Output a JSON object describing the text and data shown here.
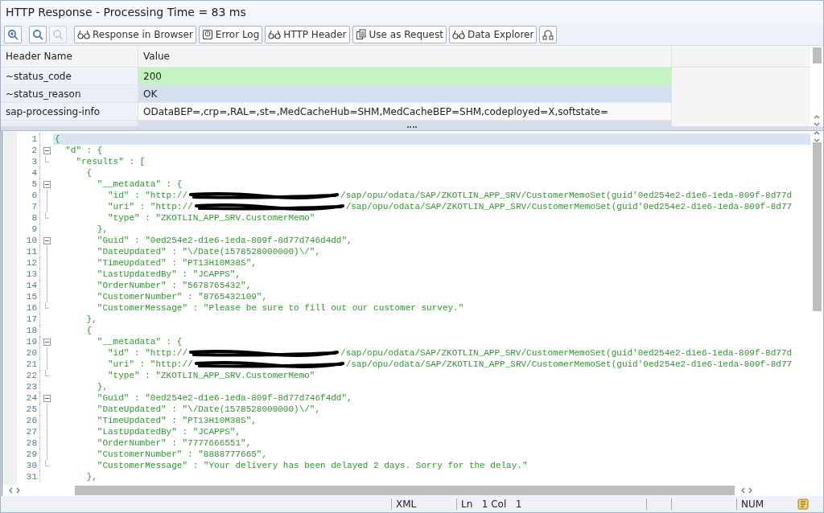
{
  "window": {
    "title": "HTTP Response - Processing Time = 83  ms"
  },
  "toolbar": [
    {
      "disabled": false
    },
    {
      "disabled": false
    },
    {
      "disabled": true
    },
    {
      "label": "Response in Browser",
      "disabled": false
    },
    {
      "label": "Error Log",
      "disabled": false
    },
    {
      "label": "HTTP Header",
      "disabled": false
    },
    {
      "label": "Use as Request",
      "disabled": false
    },
    {
      "label": "Data Explorer",
      "disabled": false
    },
    {
      "disabled": false
    }
  ],
  "header_table": {
    "columns": [
      "Header Name",
      "Value"
    ],
    "rows": [
      {
        "name": "~status_code",
        "value": "200",
        "color": "#c4f5c0"
      },
      {
        "name": "~status_reason",
        "value": "OK",
        "color": "#d5e0ef"
      },
      {
        "name": "sap-processing-info",
        "value": "ODataBEP=,crp=,RAL=,st=,MedCacheHub=SHM,MedCacheBEP=SHM,codeployed=X,softstate=",
        "color": "#fafafa"
      },
      {
        "color": "#d5e0ef"
      }
    ]
  },
  "editor": {
    "lines": [
      {
        "num": "1",
        "kind": "plain",
        "text": "{",
        "current": true
      },
      {
        "num": "2",
        "kind": "open",
        "text": "  \"d\" : {",
        "current": false
      },
      {
        "num": "3",
        "kind": "end",
        "text": "    \"results\" : [",
        "current": false
      },
      {
        "num": "4",
        "kind": "plain",
        "text": "      {",
        "current": false
      },
      {
        "num": "5",
        "kind": "open",
        "text": "        \"__metadata\" : {",
        "current": false
      },
      {
        "num": "6",
        "kind": "line",
        "text": "          \"id\" : \"http://",
        "redacted": true,
        "rest": "/sap/opu/odata/SAP/ZKOTLIN_APP_SRV/CustomerMemoSet(guid'0ed254e2-d1e6-1eda-809f-8d77d",
        "current": false
      },
      {
        "num": "7",
        "kind": "line",
        "text": "          \"uri\" : \"http://",
        "redacted": true,
        "rest": "/sap/opu/odata/SAP/ZKOTLIN_APP_SRV/CustomerMemoSet(guid'0ed254e2-d1e6-1eda-809f-8d77",
        "current": false
      },
      {
        "num": "8",
        "kind": "end",
        "text": "          \"type\" : \"ZKOTLIN_APP_SRV.CustomerMemo\"",
        "current": false
      },
      {
        "num": "9",
        "kind": "plain",
        "text": "        },",
        "current": false
      },
      {
        "num": "10",
        "kind": "open",
        "text": "        \"Guid\" : \"0ed254e2-d1e6-1eda-809f-8d77d746d4dd\",",
        "current": false
      },
      {
        "num": "11",
        "kind": "line",
        "text": "        \"DateUpdated\" : \"\\/Date(1578528000000)\\/\",",
        "current": false
      },
      {
        "num": "12",
        "kind": "line",
        "text": "        \"TimeUpdated\" : \"PT13H10M38S\",",
        "current": false
      },
      {
        "num": "13",
        "kind": "line",
        "text": "        \"LastUpdatedBy\" : \"JCAPPS\",",
        "current": false
      },
      {
        "num": "14",
        "kind": "line",
        "text": "        \"OrderNumber\" : \"5678765432\",",
        "current": false
      },
      {
        "num": "15",
        "kind": "line",
        "text": "        \"CustomerNumber\" : \"8765432109\",",
        "current": false
      },
      {
        "num": "16",
        "kind": "end",
        "text": "        \"CustomerMessage\" : \"Please be sure to fill out our customer survey.\"",
        "current": false
      },
      {
        "num": "17",
        "kind": "plain",
        "text": "      },",
        "current": false
      },
      {
        "num": "18",
        "kind": "plain",
        "text": "      {",
        "current": false
      },
      {
        "num": "19",
        "kind": "open",
        "text": "        \"__metadata\" : {",
        "current": false
      },
      {
        "num": "20",
        "kind": "line",
        "text": "          \"id\" : \"http://",
        "redacted": true,
        "rest": "/sap/opu/odata/SAP/ZKOTLIN_APP_SRV/CustomerMemoSet(guid'0ed254e2-d1e6-1eda-809f-8d77d",
        "current": false
      },
      {
        "num": "21",
        "kind": "line",
        "text": "          \"uri\" : \"http://",
        "redacted": true,
        "rest": "/sap/opu/odata/SAP/ZKOTLIN_APP_SRV/CustomerMemoSet(guid'0ed254e2-d1e6-1eda-809f-8d77",
        "current": false
      },
      {
        "num": "22",
        "kind": "end",
        "text": "          \"type\" : \"ZKOTLIN_APP_SRV.CustomerMemo\"",
        "current": false
      },
      {
        "num": "23",
        "kind": "plain",
        "text": "        },",
        "current": false
      },
      {
        "num": "24",
        "kind": "open",
        "text": "        \"Guid\" : \"0ed254e2-d1e6-1eda-809f-8d77d746f4dd\",",
        "current": false
      },
      {
        "num": "25",
        "kind": "line",
        "text": "        \"DateUpdated\" : \"\\/Date(1578528000000)\\/\",",
        "current": false
      },
      {
        "num": "26",
        "kind": "line",
        "text": "        \"TimeUpdated\" : \"PT13H10M38S\",",
        "current": false
      },
      {
        "num": "27",
        "kind": "line",
        "text": "        \"LastUpdatedBy\" : \"JCAPPS\",",
        "current": false
      },
      {
        "num": "28",
        "kind": "line",
        "text": "        \"OrderNumber\" : \"7777666551\",",
        "current": false
      },
      {
        "num": "29",
        "kind": "line",
        "text": "        \"CustomerNumber\" : \"8888777665\",",
        "current": false
      },
      {
        "num": "30",
        "kind": "end",
        "text": "        \"CustomerMessage\" : \"Your delivery has been delayed 2 days. Sorry for the delay.\"",
        "current": false
      },
      {
        "num": "31",
        "kind": "plain",
        "text": "      },",
        "current": false
      }
    ]
  },
  "status_bar": {
    "format": "XML",
    "position": "Ln   1 Col   1",
    "mode": "NUM"
  }
}
